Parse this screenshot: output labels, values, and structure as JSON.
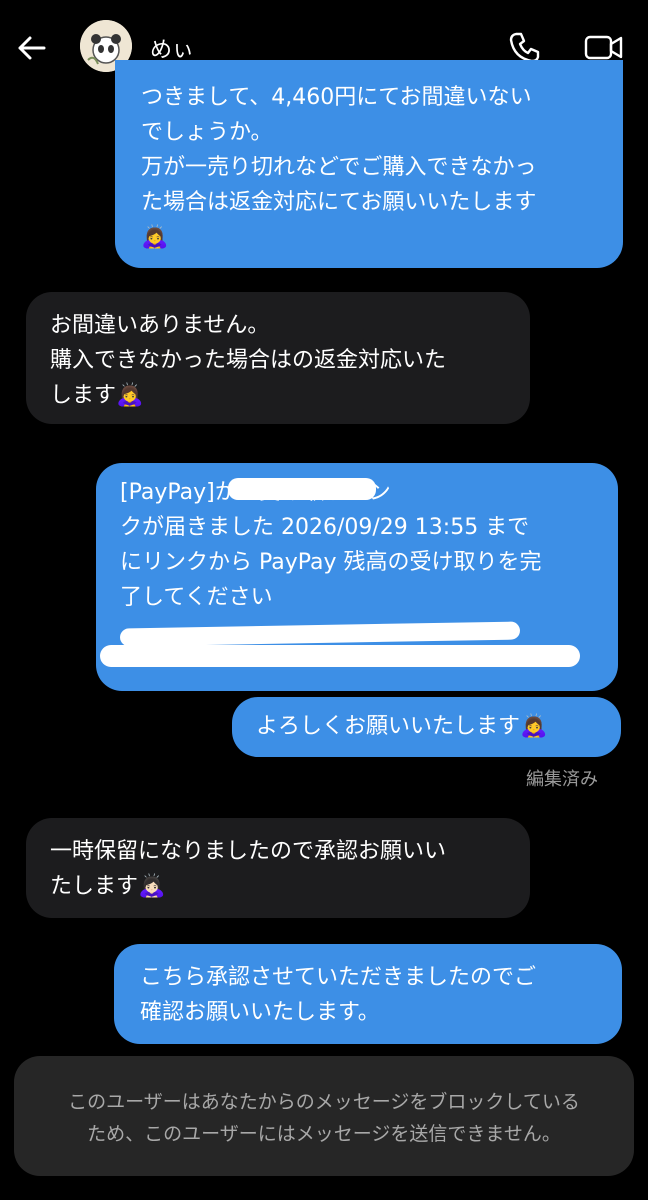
{
  "header": {
    "username": "めぃ",
    "back_icon": "arrow-left-icon",
    "call_icon": "phone-icon",
    "video_icon": "video-camera-icon"
  },
  "messages": [
    {
      "direction": "outgoing",
      "text": "つきまして、4,460円にてお間違いない\nでしょうか。\n万が一売り切れなどでご購入できなかっ\nた場合は返金対応にてお願いいたします\n🙇‍♀️"
    },
    {
      "direction": "incoming",
      "text": "お間違いありません。\n購入できなかった場合はの返金対応いた\nします🙇‍♀️"
    },
    {
      "direction": "outgoing",
      "text": "[PayPay]から受け取りリン\nクが届きました 2026/09/29 13:55 まで\nにリンクから PayPay 残高の受け取りを完\n了してください"
    },
    {
      "direction": "outgoing",
      "text": "よろしくお願いいたします🙇‍♀️"
    },
    {
      "direction": "incoming",
      "text": "一時保留になりましたので承認お願いい\nたします🙇🏻‍♀️"
    },
    {
      "direction": "outgoing",
      "text": "こちら承認させていただきましたのでご\n確認お願いいたします。"
    }
  ],
  "edited_label": "編集済み",
  "notice": "このユーザーはあなたからのメッセージをブロックしている\nため、このユーザーにはメッセージを送信できません。",
  "colors": {
    "outgoing_bubble": "#3d8fe6",
    "incoming_bubble": "#1c1c1e",
    "background": "#000000"
  }
}
